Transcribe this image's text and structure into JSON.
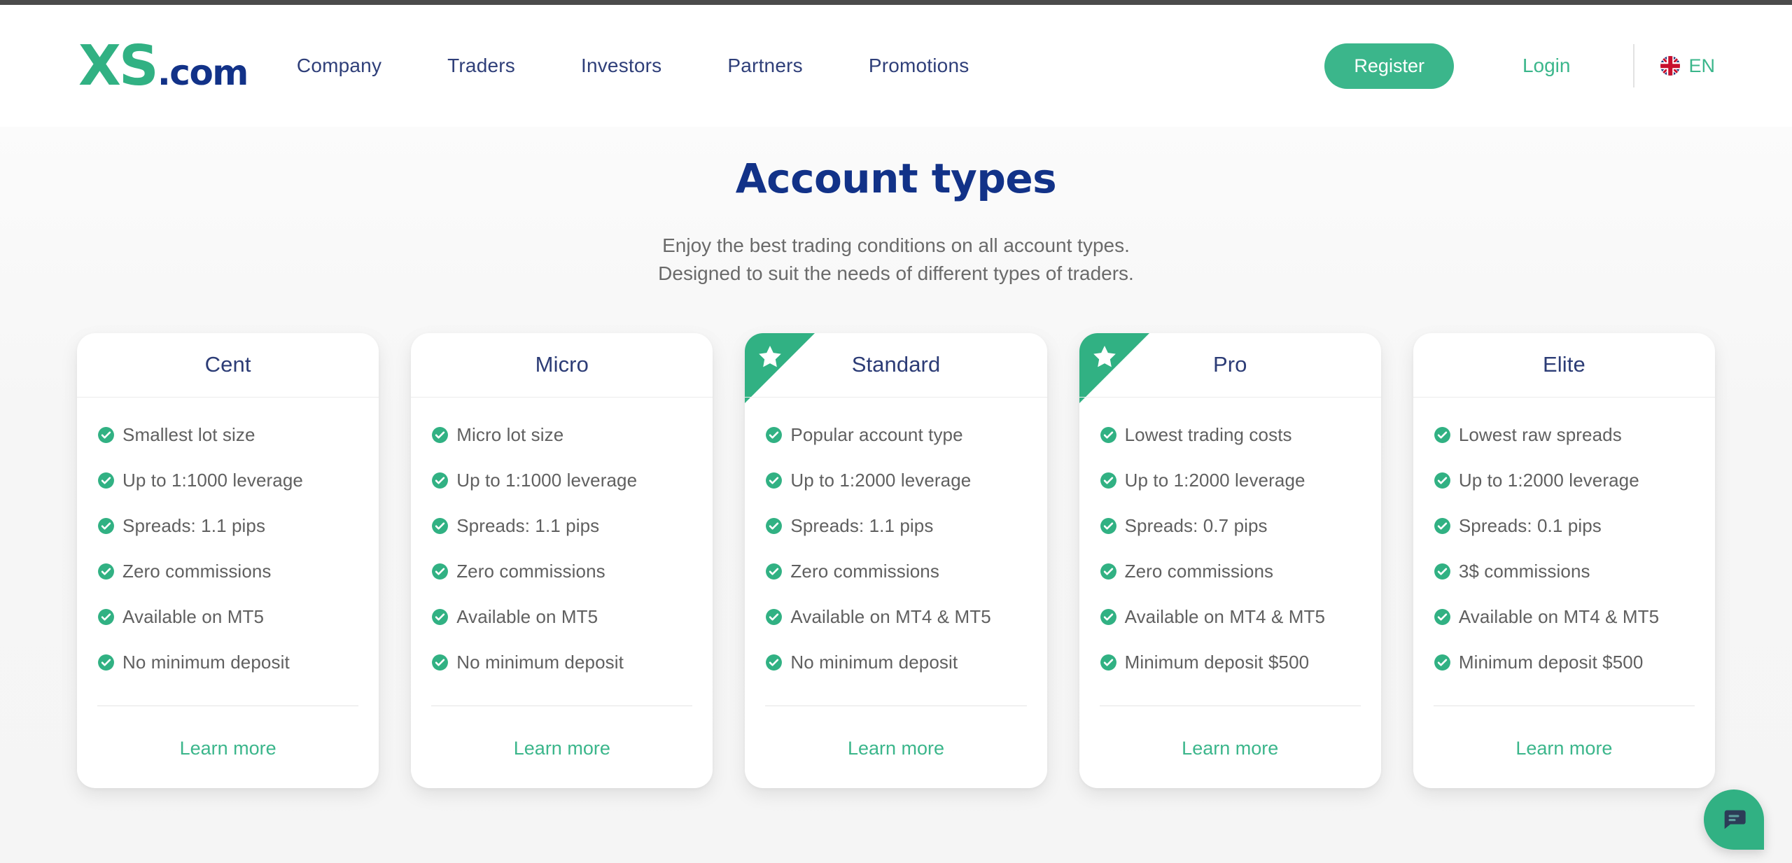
{
  "brand": {
    "logo_main": "XS",
    "logo_suffix": ".com",
    "green": "#31b183",
    "navy": "#123288"
  },
  "header": {
    "nav_items": [
      {
        "label": "Company",
        "name": "nav-company"
      },
      {
        "label": "Traders",
        "name": "nav-traders"
      },
      {
        "label": "Investors",
        "name": "nav-investors"
      },
      {
        "label": "Partners",
        "name": "nav-partners"
      },
      {
        "label": "Promotions",
        "name": "nav-promotions"
      }
    ],
    "register_label": "Register",
    "login_label": "Login",
    "language_code": "EN",
    "language_flag_icon": "uk-flag-icon"
  },
  "hero": {
    "title": "Account types",
    "subtitle_line1": "Enjoy the best trading conditions on all account types.",
    "subtitle_line2": "Designed to suit the needs of different types of traders."
  },
  "cards": [
    {
      "title": "Cent",
      "featured": false,
      "badge_icon": null,
      "features": [
        "Smallest lot size",
        "Up to 1:1000 leverage",
        "Spreads: 1.1 pips",
        "Zero commissions",
        "Available on MT5",
        "No minimum deposit"
      ],
      "cta_label": "Learn more"
    },
    {
      "title": "Micro",
      "featured": false,
      "badge_icon": null,
      "features": [
        "Micro lot size",
        "Up to 1:1000 leverage",
        "Spreads: 1.1 pips",
        "Zero commissions",
        "Available on MT5",
        "No minimum deposit"
      ],
      "cta_label": "Learn more"
    },
    {
      "title": "Standard",
      "featured": true,
      "badge_icon": "star-icon",
      "features": [
        "Popular account type",
        "Up to 1:2000 leverage",
        "Spreads: 1.1 pips",
        "Zero commissions",
        "Available on MT4 & MT5",
        "No minimum deposit"
      ],
      "cta_label": "Learn more"
    },
    {
      "title": "Pro",
      "featured": true,
      "badge_icon": "star-icon",
      "features": [
        "Lowest trading costs",
        "Up to 1:2000 leverage",
        "Spreads: 0.7 pips",
        "Zero commissions",
        "Available on MT4 & MT5",
        "Minimum deposit $500"
      ],
      "cta_label": "Learn more"
    },
    {
      "title": "Elite",
      "featured": false,
      "badge_icon": null,
      "features": [
        "Lowest raw spreads",
        "Up to 1:2000 leverage",
        "Spreads: 0.1 pips",
        "3$ commissions",
        "Available on MT4 & MT5",
        "Minimum deposit $500"
      ],
      "cta_label": "Learn more"
    }
  ],
  "chat_widget": {
    "icon": "chat-bubble-icon"
  }
}
